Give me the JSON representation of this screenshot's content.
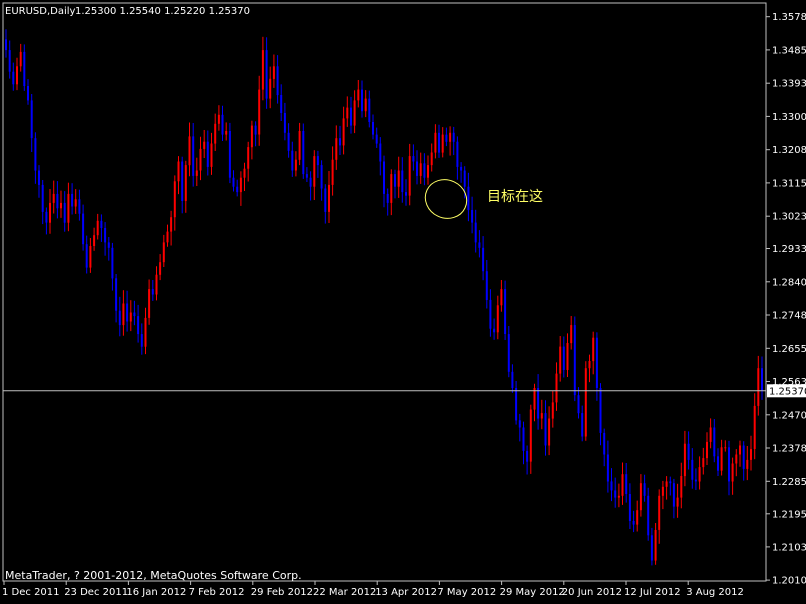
{
  "header": {
    "symbol_text": "EURUSD,Daily",
    "ohlc_text": "1.25300 1.25540 1.25220 1.25370"
  },
  "annotation": {
    "text": "目标在这"
  },
  "footer": {
    "copyright": "MetaTrader, ? 2001-2012, MetaQuotes Software Corp."
  },
  "colors": {
    "background": "#000000",
    "bull": "#ff0000",
    "bear": "#0000ff",
    "text": "#ffffff",
    "annotation": "#ffff66"
  },
  "chart_data": {
    "type": "candlestick",
    "ylim": [
      1.2008,
      1.3616
    ],
    "y_ticks": [
      "1.35780",
      "1.34855",
      "1.33930",
      "1.33005",
      "1.32080",
      "1.31155",
      "1.30230",
      "1.29330",
      "1.28405",
      "1.27480",
      "1.26555",
      "1.25630",
      "1.24705",
      "1.23780",
      "1.22855",
      "1.21950",
      "1.21030",
      "1.20105"
    ],
    "current_price_label": "1.25370",
    "x_ticks": [
      "1 Dec 2011",
      "23 Dec 2011",
      "16 Jan 2012",
      "7 Feb 2012",
      "29 Feb 2012",
      "22 Mar 2012",
      "13 Apr 2012",
      "7 May 2012",
      "29 May 2012",
      "20 Jun 2012",
      "12 Jul 2012",
      "3 Aug 2012"
    ],
    "closes": [
      1.3485,
      1.3425,
      1.339,
      1.344,
      1.348,
      1.3385,
      1.3345,
      1.324,
      1.315,
      1.311,
      1.3035,
      1.3005,
      1.306,
      1.3085,
      1.3045,
      1.306,
      1.3005,
      1.3085,
      1.305,
      1.307,
      1.303,
      1.2945,
      1.288,
      1.294,
      1.297,
      1.301,
      1.299,
      1.295,
      1.2935,
      1.285,
      1.276,
      1.272,
      1.278,
      1.273,
      1.2755,
      1.2745,
      1.2695,
      1.266,
      1.274,
      1.282,
      1.2805,
      1.286,
      1.2895,
      1.295,
      1.298,
      1.302,
      1.312,
      1.3175,
      1.3065,
      1.3165,
      1.3245,
      1.3135,
      1.315,
      1.321,
      1.323,
      1.316,
      1.3225,
      1.328,
      1.3305,
      1.325,
      1.326,
      1.313,
      1.3105,
      1.309,
      1.313,
      1.3155,
      1.3215,
      1.3275,
      1.325,
      1.3375,
      1.3485,
      1.335,
      1.3405,
      1.344,
      1.336,
      1.331,
      1.3255,
      1.3205,
      1.315,
      1.318,
      1.326,
      1.314,
      1.313,
      1.3105,
      1.319,
      1.3165,
      1.31,
      1.3035,
      1.311,
      1.318,
      1.324,
      1.322,
      1.3295,
      1.3325,
      1.3275,
      1.3345,
      1.3375,
      1.3315,
      1.335,
      1.3285,
      1.325,
      1.3225,
      1.3175,
      1.3085,
      1.306,
      1.314,
      1.3105,
      1.315,
      1.309,
      1.308,
      1.319,
      1.3175,
      1.3135,
      1.317,
      1.313,
      1.3165,
      1.32,
      1.3255,
      1.32,
      1.325,
      1.323,
      1.3255,
      1.323,
      1.316,
      1.315,
      1.3105,
      1.304,
      1.3005,
      1.295,
      1.2935,
      1.287,
      1.279,
      1.271,
      1.27,
      1.2775,
      1.282,
      1.2695,
      1.259,
      1.2545,
      1.2455,
      1.2435,
      1.237,
      1.234,
      1.2485,
      1.2545,
      1.246,
      1.2475,
      1.2385,
      1.246,
      1.2505,
      1.2585,
      1.266,
      1.2595,
      1.267,
      1.272,
      1.2525,
      1.2475,
      1.241,
      1.26,
      1.262,
      1.2685,
      1.2545,
      1.242,
      1.236,
      1.2285,
      1.226,
      1.224,
      1.2245,
      1.2305,
      1.225,
      1.2175,
      1.2165,
      1.2205,
      1.228,
      1.2245,
      1.2135,
      1.2065,
      1.215,
      1.2245,
      1.227,
      1.2285,
      1.228,
      1.2215,
      1.224,
      1.23,
      1.239,
      1.2345,
      1.229,
      1.2285,
      1.2325,
      1.235,
      1.2395,
      1.2435,
      1.2355,
      1.2315,
      1.238,
      1.238,
      1.2285,
      1.2335,
      1.236,
      1.2385,
      1.232,
      1.2345,
      1.2375,
      1.2495,
      1.26,
      1.2537
    ]
  }
}
